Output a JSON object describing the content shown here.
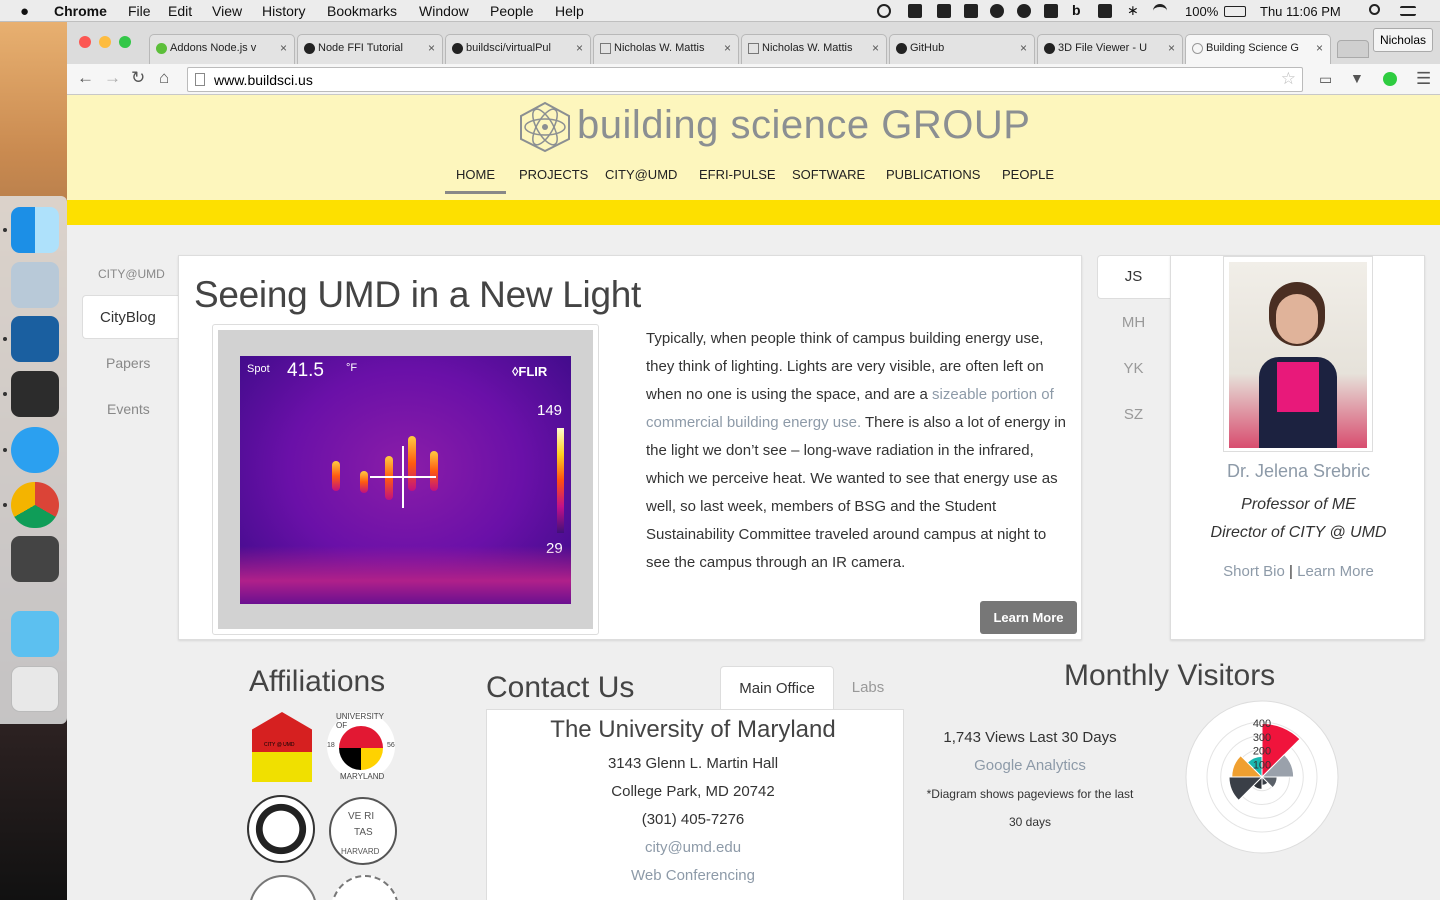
{
  "menubar": {
    "apple": "",
    "app": "Chrome",
    "items": [
      "File",
      "Edit",
      "View",
      "History",
      "Bookmarks",
      "Window",
      "People",
      "Help"
    ],
    "battery": "100%",
    "clock": "Thu 11:06 PM"
  },
  "tabs": [
    {
      "label": "Addons Node.js v"
    },
    {
      "label": "Node FFI Tutorial"
    },
    {
      "label": "buildsci/virtualPul"
    },
    {
      "label": "Nicholas W. Mattis"
    },
    {
      "label": "Nicholas W. Mattis"
    },
    {
      "label": "GitHub"
    },
    {
      "label": "3D File Viewer - U"
    },
    {
      "label": "Building Science G"
    }
  ],
  "profile_label": "Nicholas",
  "toolbar": {
    "url": "www.buildsci.us"
  },
  "site": {
    "brand": "building science GROUP",
    "nav": [
      "HOME",
      "PROJECTS",
      "CITY@UMD",
      "EFRI-PULSE",
      "SOFTWARE",
      "PUBLICATIONS",
      "PEOPLE"
    ],
    "side_nav": [
      "CITY@UMD",
      "CityBlog",
      "Papers",
      "Events"
    ],
    "post": {
      "title": "Seeing UMD in a New Light",
      "ir": {
        "spot_label": "Spot",
        "spot_value": "41.5",
        "unit": "°F",
        "brand": "◊FLIR",
        "max": "149",
        "min": "29"
      },
      "text_a": "Typically, when people think of campus building energy use, they think of lighting. Lights are very visible, are often left on when no one is using the space, and are a ",
      "text_link": "sizeable portion of commercial building energy use.",
      "text_b": " There is also a lot of energy in the light we don’t see – long-wave radiation in the infrared, which we perceive heat. We wanted to see that energy use as well, so last week, members of BSG and the Student Sustainability Committee traveled around campus at night to see the campus through an IR camera.",
      "button": "Learn More"
    },
    "people_initials": [
      "JS",
      "MH",
      "YK",
      "SZ"
    ],
    "profile": {
      "name": "Dr. Jelena Srebric",
      "role1": "Professor of ME",
      "role2": "Director of CITY @ UMD",
      "link1": "Short Bio",
      "sep": "|",
      "link2": "Learn More"
    },
    "affiliations": {
      "title": "Affiliations",
      "seal_text": {
        "umd_top": "UNIVERSITY OF",
        "umd_bottom": "MARYLAND",
        "umd_y1": "18",
        "umd_y2": "56",
        "city": "CITY @ UMD",
        "ve": "VE RI",
        "ta": "TAS",
        "harvard": "HARVARD"
      }
    },
    "contact": {
      "title": "Contact Us",
      "tabs": [
        "Main Office",
        "Labs"
      ],
      "org": "The University of Maryland",
      "addr1": "3143 Glenn L. Martin Hall",
      "addr2": "College Park, MD 20742",
      "phone": "(301) 405-7276",
      "email": "city@umd.edu",
      "webconf": "Web Conferencing"
    },
    "visitors": {
      "title": "Monthly Visitors",
      "views": "1,743 Views Last 30 Days",
      "ga": "Google Analytics",
      "note1": "*Diagram shows pageviews for the last",
      "note2": "30 days"
    }
  },
  "chart_data": {
    "type": "polar-area",
    "ticks": [
      "400",
      "300",
      "200",
      "100"
    ],
    "rmax": 400,
    "series": [
      {
        "values": [
          390,
          230,
          110,
          60,
          90,
          240,
          220,
          150
        ],
        "colors": [
          "#f0143c",
          "#9aa1ab",
          "#5a6068",
          "#3a3f47",
          "#2e3238",
          "#3a3f47",
          "#f0a030",
          "#19b8b0"
        ]
      }
    ]
  },
  "colors": {
    "header_bg": "#fdf6bd",
    "yellow_band": "#fde000",
    "link": "#8d9aa8",
    "button": "#777777"
  }
}
